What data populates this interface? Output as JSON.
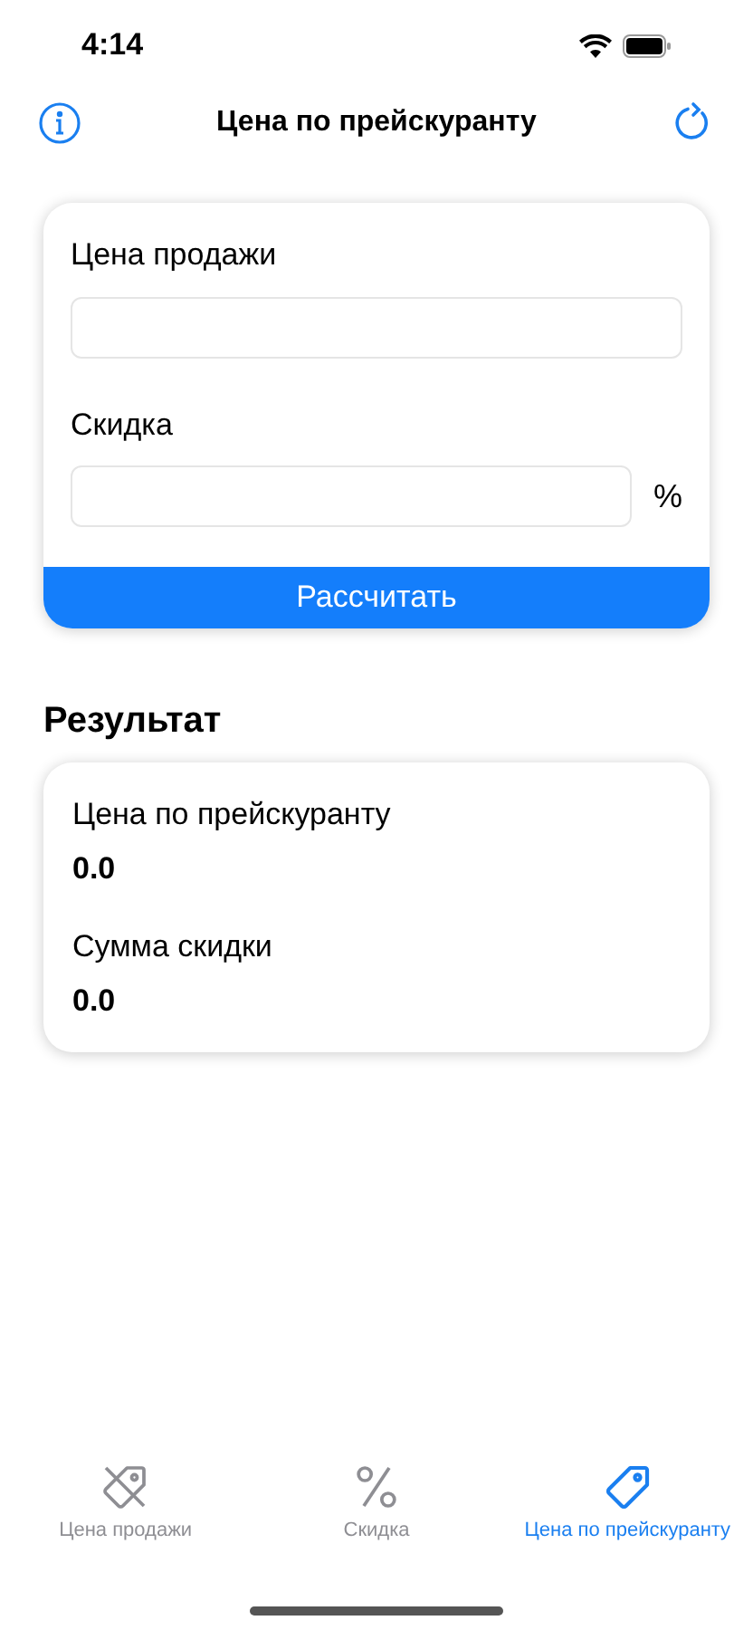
{
  "status_bar": {
    "time": "4:14"
  },
  "nav": {
    "title": "Цена по прейскуранту"
  },
  "form": {
    "fields": [
      {
        "label": "Цена продажи"
      },
      {
        "label": "Скидка",
        "suffix": "%"
      }
    ],
    "button": "Рассчитать"
  },
  "result": {
    "heading": "Результат",
    "items": [
      {
        "label": "Цена по прейскуранту",
        "value": "0.0"
      },
      {
        "label": "Сумма скидки",
        "value": "0.0"
      }
    ]
  },
  "tab_bar": [
    {
      "kind": "tag-off",
      "label": "Цена продажи",
      "selected": false
    },
    {
      "kind": "percent",
      "label": "Скидка",
      "selected": false
    },
    {
      "kind": "tag",
      "label": "Цена по прейскуранту",
      "selected": true
    }
  ]
}
